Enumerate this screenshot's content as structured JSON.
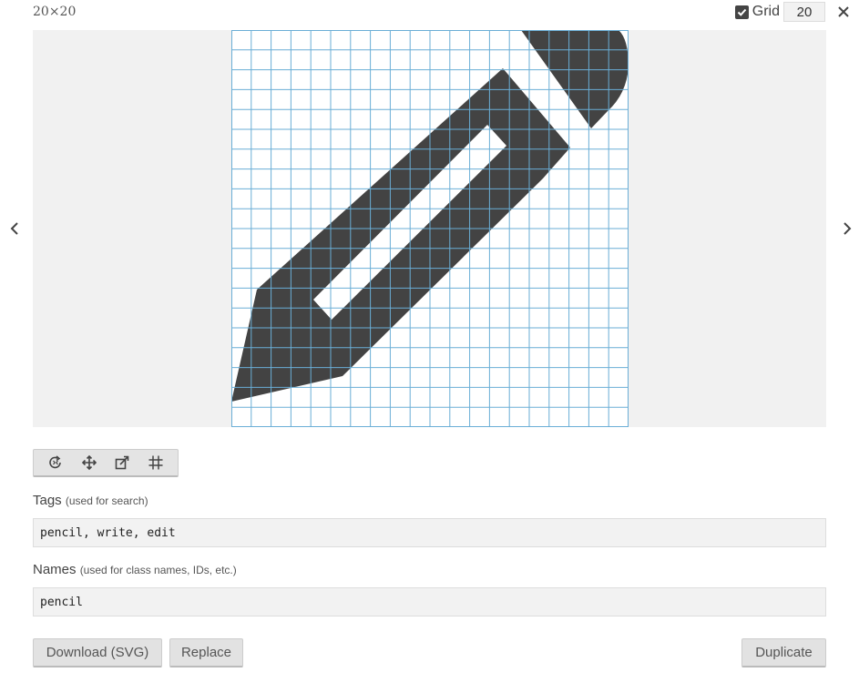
{
  "header": {
    "size_label": "20×20",
    "grid_checked": true,
    "grid_label": "Grid",
    "grid_size": "20",
    "close_icon": "close-icon"
  },
  "preview": {
    "prev_icon": "chevron-left-icon",
    "next_icon": "chevron-right-icon",
    "icon_name": "pencil-icon",
    "icon_color": "#434343",
    "grid_line_color": "#6aaed6"
  },
  "toolbar": {
    "tools": [
      "rotate-icon",
      "move-icon",
      "resize-icon",
      "grid-frame-icon"
    ]
  },
  "tags": {
    "label": "Tags",
    "hint": "(used for search)",
    "value": "pencil, write, edit"
  },
  "names": {
    "label": "Names",
    "hint": "(used for class names, IDs, etc.)",
    "value": "pencil"
  },
  "actions": {
    "download_label": "Download (SVG)",
    "replace_label": "Replace",
    "duplicate_label": "Duplicate"
  }
}
